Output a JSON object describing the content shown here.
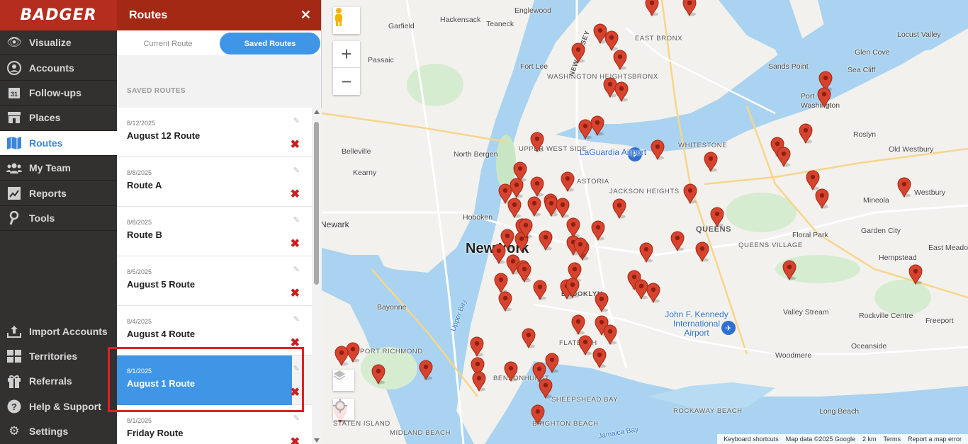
{
  "app": {
    "logo": "BADGER"
  },
  "nav": {
    "items": [
      {
        "label": "Visualize",
        "icon": "eye-icon"
      },
      {
        "label": "Accounts",
        "icon": "person-icon"
      },
      {
        "label": "Follow-ups",
        "icon": "calendar-icon"
      },
      {
        "label": "Places",
        "icon": "store-icon"
      },
      {
        "label": "Routes",
        "icon": "map-icon",
        "active": true
      },
      {
        "label": "My Team",
        "icon": "team-icon"
      },
      {
        "label": "Reports",
        "icon": "chart-icon"
      },
      {
        "label": "Tools",
        "icon": "wrench-icon"
      }
    ],
    "bottom_items": [
      {
        "label": "Import Accounts",
        "icon": "upload-icon"
      },
      {
        "label": "Territories",
        "icon": "grid-icon"
      },
      {
        "label": "Referrals",
        "icon": "gift-icon"
      },
      {
        "label": "Help & Support",
        "icon": "help-icon"
      },
      {
        "label": "Settings",
        "icon": "gear-icon"
      }
    ]
  },
  "panel": {
    "title": "Routes",
    "close": "✕",
    "tabs": {
      "current": "Current Route",
      "saved": "Saved Routes"
    },
    "saved_heading": "SAVED ROUTES",
    "routes": [
      {
        "date": "8/12/2025",
        "name": "August 12 Route"
      },
      {
        "date": "8/8/2025",
        "name": "Route A"
      },
      {
        "date": "8/8/2025",
        "name": "Route B"
      },
      {
        "date": "8/5/2025",
        "name": "August 5 Route"
      },
      {
        "date": "8/4/2025",
        "name": "August 4 Route"
      },
      {
        "date": "8/1/2025",
        "name": "August 1 Route",
        "selected": true
      },
      {
        "date": "8/1/2025",
        "name": "Friday Route"
      }
    ],
    "delete_glyph": "✖",
    "edit_glyph": "✎"
  },
  "map": {
    "zoom_in": "+",
    "zoom_out": "−",
    "labels": {
      "newyork": "New York",
      "newark": "Newark",
      "queens": "QUEENS",
      "brooklyn": "BROOKLYN",
      "bronx": "BRONX",
      "eastbronx": "EAST BRONX",
      "hoboken": "Hoboken",
      "northbergen": "North Bergen",
      "upperwestside": "UPPER WEST SIDE",
      "washingtonheights": "WASHINGTON HEIGHTS",
      "astoria": "ASTORIA",
      "jacksonheights": "JACKSON HEIGHTS",
      "whitestone": "WHITESTONE",
      "laguardia": "LaGuardia Airport",
      "jfk": "John F. Kennedy International Airport",
      "bayonne": "Bayonne",
      "belleville": "Belleville",
      "kearny": "Kearny",
      "passaic": "Passaic",
      "garfield": "Garfield",
      "hackensack": "Hackensack",
      "teaneck": "Teaneck",
      "englewood": "Englewood",
      "fortlee": "Fort Lee",
      "newjersey": "NEW JERSEY",
      "flatbush": "FLATBUSH",
      "bensonhurst": "BENSONHURST",
      "sheepsheadbay": "SHEEPSHEAD BAY",
      "brightonbeach": "BRIGHTON BEACH",
      "statenisland": "STATEN ISLAND",
      "midlandbeach": "MIDLAND BEACH",
      "rockaway": "ROCKAWAY BEACH",
      "longbeach": "Long Beach",
      "oceanside": "Oceanside",
      "woodmere": "Woodmere",
      "freeport": "Freeport",
      "rockville": "Rockville Centre",
      "valleystream": "Valley Stream",
      "hempstead": "Hempstead",
      "eastmeadow": "East Meadow",
      "gardencity": "Garden City",
      "floralpark": "Floral Park",
      "mineola": "Mineola",
      "westbury": "Westbury",
      "oldwestbury": "Old Westbury",
      "roslyn": "Roslyn",
      "portwashington": "Port Washington",
      "sandspoint": "Sands Point",
      "glencove": "Glen Cove",
      "seacliff": "Sea Cliff",
      "locustvalley": "Locust Valley",
      "queensvillage": "QUEENS VILLAGE",
      "portrichmond": "PORT RICHMOND",
      "upperbay": "Upper Bay",
      "jamaicabay": "Jamaica Bay"
    },
    "attribution": [
      "Keyboard shortcuts",
      "Map data ©2025 Google",
      "2 km",
      "Terms",
      "Report a map error"
    ]
  }
}
